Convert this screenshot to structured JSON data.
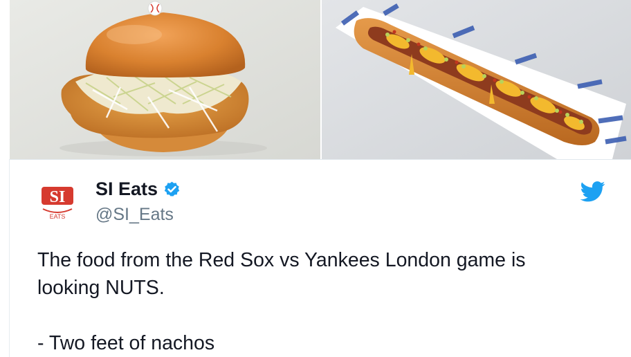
{
  "media": {
    "left_photo_label": "fried-chicken-sandwich-photo",
    "right_photo_label": "loaded-hot-dog-photo"
  },
  "tweet": {
    "author_name": "SI Eats",
    "author_handle": "@SI_Eats",
    "avatar_text_main": "SI",
    "avatar_text_sub": "EATS",
    "verified": true,
    "text_line_1": "The food from the Red Sox vs Yankees London game is",
    "text_line_2": "looking NUTS.",
    "text_line_3": "- Two feet of nachos"
  },
  "colors": {
    "twitter_blue": "#1da1f2",
    "handle_gray": "#657786",
    "text_dark": "#141823",
    "si_red": "#d63a2f"
  },
  "icons": {
    "verified": "verified-badge-icon",
    "brand": "twitter-bird-icon"
  }
}
